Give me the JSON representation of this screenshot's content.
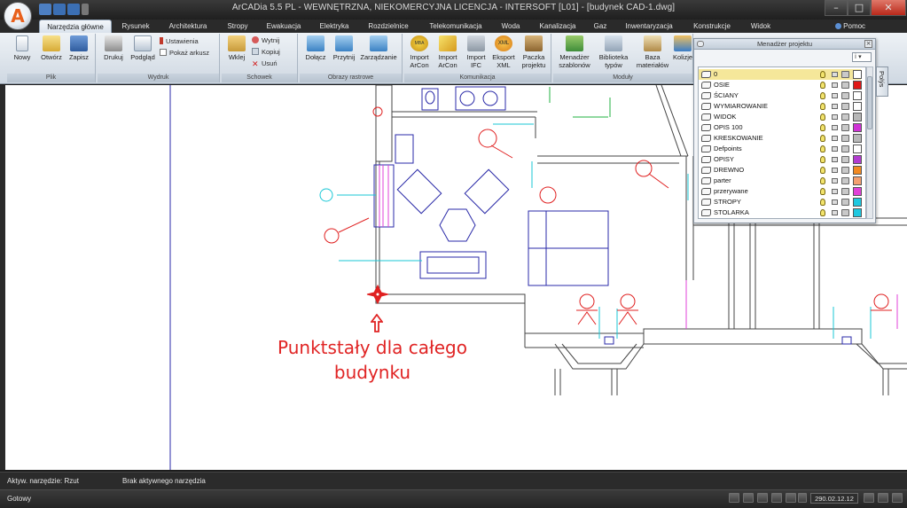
{
  "window": {
    "title": "ArCADia 5.5 PL - WEWNĘTRZNA, NIEKOMERCYJNA LICENCJA - INTERSOFT [L01] - [budynek CAD-1.dwg]",
    "logo_letter": "A",
    "help_label": "Pomoc",
    "minimize": "–",
    "maximize": "□",
    "close": "✕"
  },
  "tabs": [
    {
      "label": "Narzędzia główne",
      "active": true
    },
    {
      "label": "Rysunek"
    },
    {
      "label": "Architektura"
    },
    {
      "label": "Stropy"
    },
    {
      "label": "Ewakuacja"
    },
    {
      "label": "Elektryka"
    },
    {
      "label": "Rozdzielnice"
    },
    {
      "label": "Telekomunikacja"
    },
    {
      "label": "Woda"
    },
    {
      "label": "Kanalizacja"
    },
    {
      "label": "Gaz"
    },
    {
      "label": "Inwentaryzacja"
    },
    {
      "label": "Konstrukcje"
    },
    {
      "label": "Widok"
    }
  ],
  "ribbon": {
    "groups": [
      {
        "label": "Plik"
      },
      {
        "label": "Wydruk"
      },
      {
        "label": "Schowek"
      },
      {
        "label": "Obrazy rastrowe"
      },
      {
        "label": "Komunikacja"
      },
      {
        "label": "Moduły"
      }
    ],
    "buttons": {
      "nowy": "Nowy",
      "otworz": "Otwórz",
      "zapisz": "Zapisz",
      "drukuj": "Drukuj",
      "podglad": "Podgląd",
      "ustawienia": "Ustawienia",
      "pokaz_arkusz": "Pokaż arkusz",
      "wklej": "Wklej",
      "wytnij": "Wytnij",
      "kopiuj": "Kopiuj",
      "usun": "Usuń",
      "dolacz": "Dołącz",
      "przytnij": "Przytnij",
      "zarzadzanie": "Zarządzanie",
      "import_arcon_1": "Import",
      "import_arcon_1b": "ArCon",
      "import_arcon_2": "Import",
      "import_arcon_2b": "ArCon",
      "import_ifc": "Import",
      "import_ifc_b": "IFC",
      "eksport_xml": "Eksport",
      "eksport_xml_b": "XML",
      "paczka": "Paczka",
      "paczka_b": "projektu",
      "menadzer": "Menadżer",
      "menadzer_b": "szablonów",
      "biblioteka": "Biblioteka",
      "biblioteka_b": "typów",
      "baza": "Baza",
      "baza_b": "materiałów",
      "kolizje": "Kolizje"
    },
    "icon_badges": {
      "mba": "MBA",
      "xml": "XML"
    }
  },
  "project_manager": {
    "title": "Menadżer projektu",
    "combo_value": "i",
    "side_tab": "Polýs",
    "layers": [
      {
        "name": "0",
        "color": "#ffffff",
        "current": true
      },
      {
        "name": "OSIE",
        "color": "#e01818"
      },
      {
        "name": "ŚCIANY",
        "color": "#ffffff"
      },
      {
        "name": "WYMIAROWANIE",
        "color": "#ffffff"
      },
      {
        "name": "WIDOK",
        "color": "#b8b8b8"
      },
      {
        "name": "OPIS 100",
        "color": "#d033d6"
      },
      {
        "name": "KRESKOWANIE",
        "color": "#b8b8b8"
      },
      {
        "name": "Defpoints",
        "color": "#ffffff"
      },
      {
        "name": "OPISY",
        "color": "#b23cd0"
      },
      {
        "name": "DREWNO",
        "color": "#f28a22"
      },
      {
        "name": "parter",
        "color": "#f4a070"
      },
      {
        "name": "przerywane",
        "color": "#e040d8"
      },
      {
        "name": "STROPY",
        "color": "#1ec8e0"
      },
      {
        "name": "STOLARKA",
        "color": "#1ec8e0"
      }
    ]
  },
  "status": {
    "active_tool": "Aktyw. narzędzie: Rzut",
    "no_tool": "Brak aktywnego narzędzia",
    "ready": "Gotowy",
    "zoom": "290.02.12.12"
  },
  "annotation": {
    "line1": "Punktstały dla całego",
    "line2": "budynku"
  },
  "colors": {
    "plan_blue": "#2a2aa8",
    "plan_red": "#e02020",
    "plan_cyan": "#19c7d6",
    "plan_gray": "#555555",
    "annotation_red": "#e02424"
  }
}
